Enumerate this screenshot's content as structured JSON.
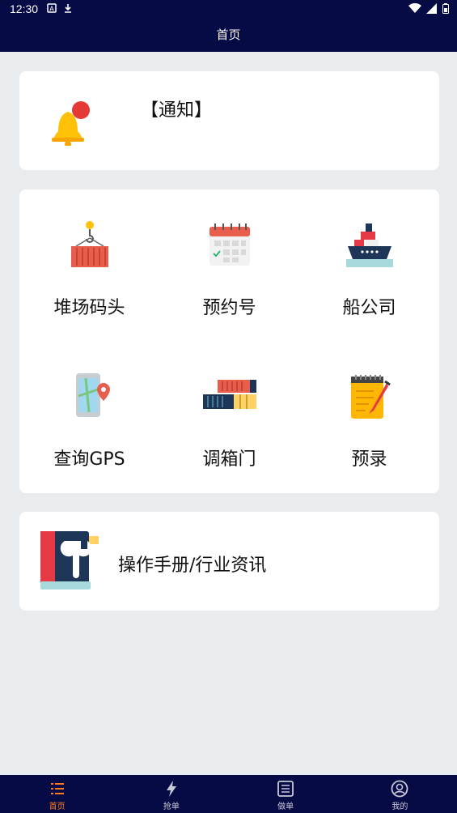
{
  "status_bar": {
    "time": "12:30"
  },
  "header": {
    "title": "首页"
  },
  "notice": {
    "label": "【通知】"
  },
  "grid_items": [
    {
      "label": "堆场码头",
      "icon": "container-crane-icon"
    },
    {
      "label": "预约号",
      "icon": "calendar-icon"
    },
    {
      "label": "船公司",
      "icon": "ship-icon"
    },
    {
      "label": "查询GPS",
      "icon": "phone-map-pin-icon"
    },
    {
      "label": "调箱门",
      "icon": "containers-stack-icon"
    },
    {
      "label": "预录",
      "icon": "notepad-pen-icon"
    }
  ],
  "manual": {
    "label": "操作手册/行业资讯"
  },
  "tabs": [
    {
      "label": "首页",
      "icon": "list-icon",
      "active": true
    },
    {
      "label": "抢单",
      "icon": "lightning-icon",
      "active": false
    },
    {
      "label": "做单",
      "icon": "document-list-icon",
      "active": false
    },
    {
      "label": "我的",
      "icon": "user-icon",
      "active": false
    }
  ],
  "colors": {
    "header_bg": "#070b45",
    "page_bg": "#e9ecef",
    "tab_active": "#ff7a1a",
    "tab_inactive": "#c7c9d6"
  }
}
